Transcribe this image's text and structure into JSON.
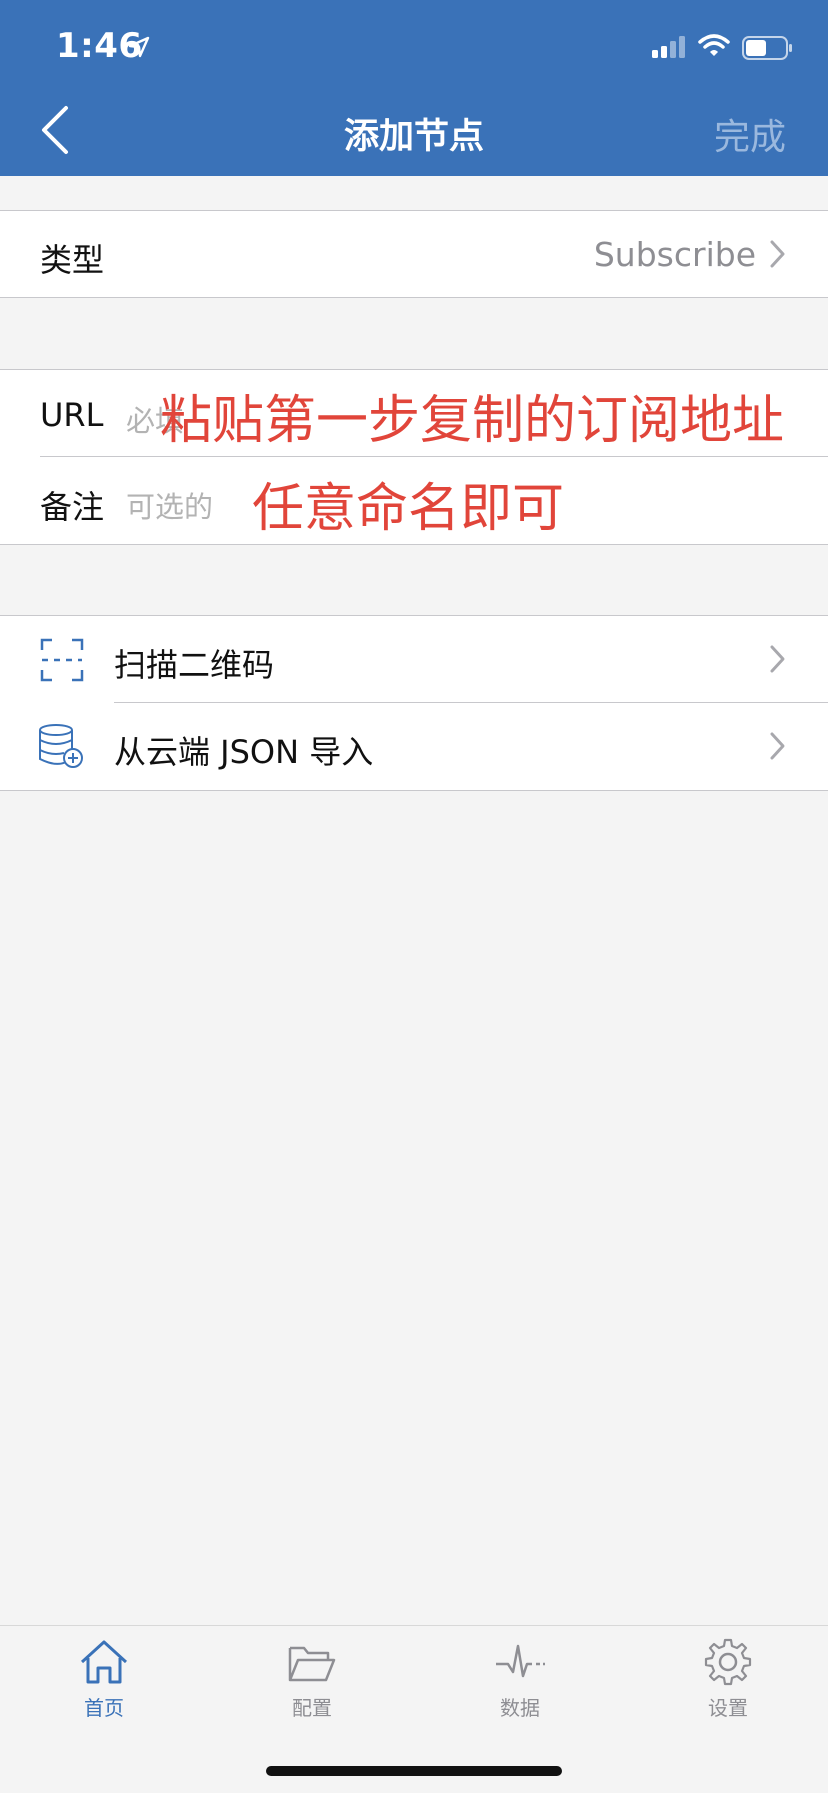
{
  "status_bar": {
    "time": "1:46"
  },
  "nav": {
    "title": "添加节点",
    "done_label": "完成"
  },
  "type_row": {
    "label": "类型",
    "value": "Subscribe"
  },
  "form": {
    "url": {
      "label": "URL",
      "placeholder": "必填"
    },
    "note": {
      "label": "备注",
      "placeholder": "可选的"
    }
  },
  "annotations": {
    "url_hint": "粘贴第一步复制的订阅地址",
    "note_hint": "任意命名即可"
  },
  "actions": [
    {
      "label": "扫描二维码",
      "icon": "qr-scan-icon"
    },
    {
      "label": "从云端 JSON 导入",
      "icon": "cloud-database-icon"
    }
  ],
  "tabs": [
    {
      "label": "首页",
      "icon": "home-icon",
      "active": true
    },
    {
      "label": "配置",
      "icon": "folder-icon",
      "active": false
    },
    {
      "label": "数据",
      "icon": "pulse-icon",
      "active": false
    },
    {
      "label": "设置",
      "icon": "gear-icon",
      "active": false
    }
  ],
  "colors": {
    "brand": "#3a72b8",
    "annotation": "#e1453a",
    "inactive_tab": "#8e8e93"
  }
}
